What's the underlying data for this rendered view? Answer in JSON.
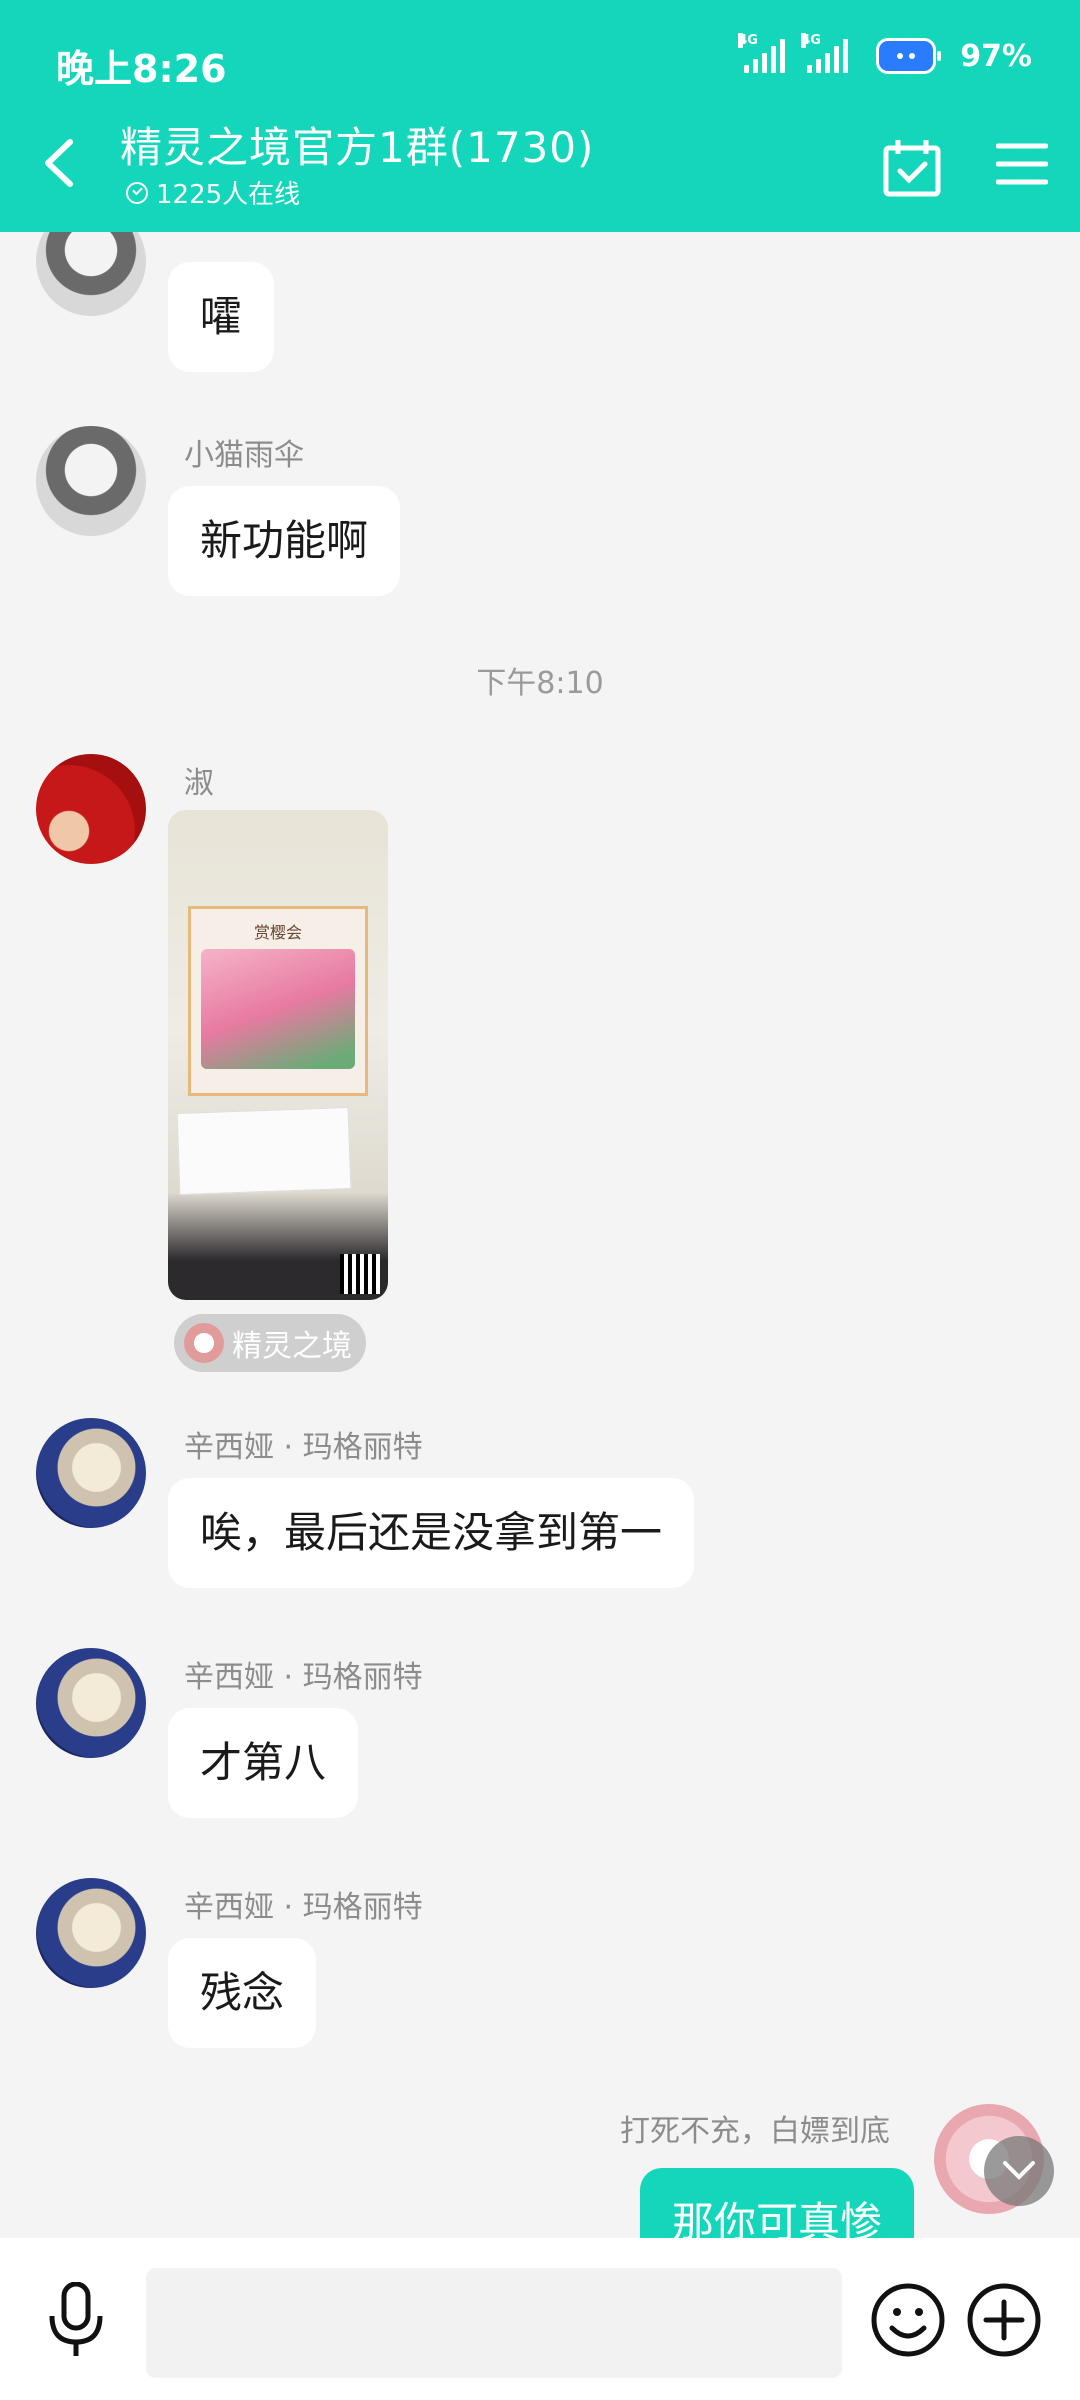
{
  "status_bar": {
    "time": "晚上8:26",
    "network1": "4G",
    "network2": "4G",
    "battery": "97%"
  },
  "header": {
    "title": "精灵之境官方1群(1730)",
    "online": "1225人在线"
  },
  "messages": [
    {
      "sender": "",
      "text": "嚯"
    },
    {
      "sender": "小猫雨伞",
      "text": "新功能啊"
    },
    {
      "timestamp": "下午8:10"
    },
    {
      "sender": "淑",
      "image_title": "赏樱会",
      "app_tag": "精灵之境"
    },
    {
      "sender": "辛西娅 · 玛格丽特",
      "text": "唉，最后还是没拿到第一"
    },
    {
      "sender": "辛西娅 · 玛格丽特",
      "text": "才第八"
    },
    {
      "sender": "辛西娅 · 玛格丽特",
      "text": "残念"
    },
    {
      "sender": "打死不充，白嫖到底",
      "text": "那你可真惨",
      "self": true
    }
  ],
  "colors": {
    "accent": "#14d6bb",
    "background": "#f4f4f4"
  }
}
